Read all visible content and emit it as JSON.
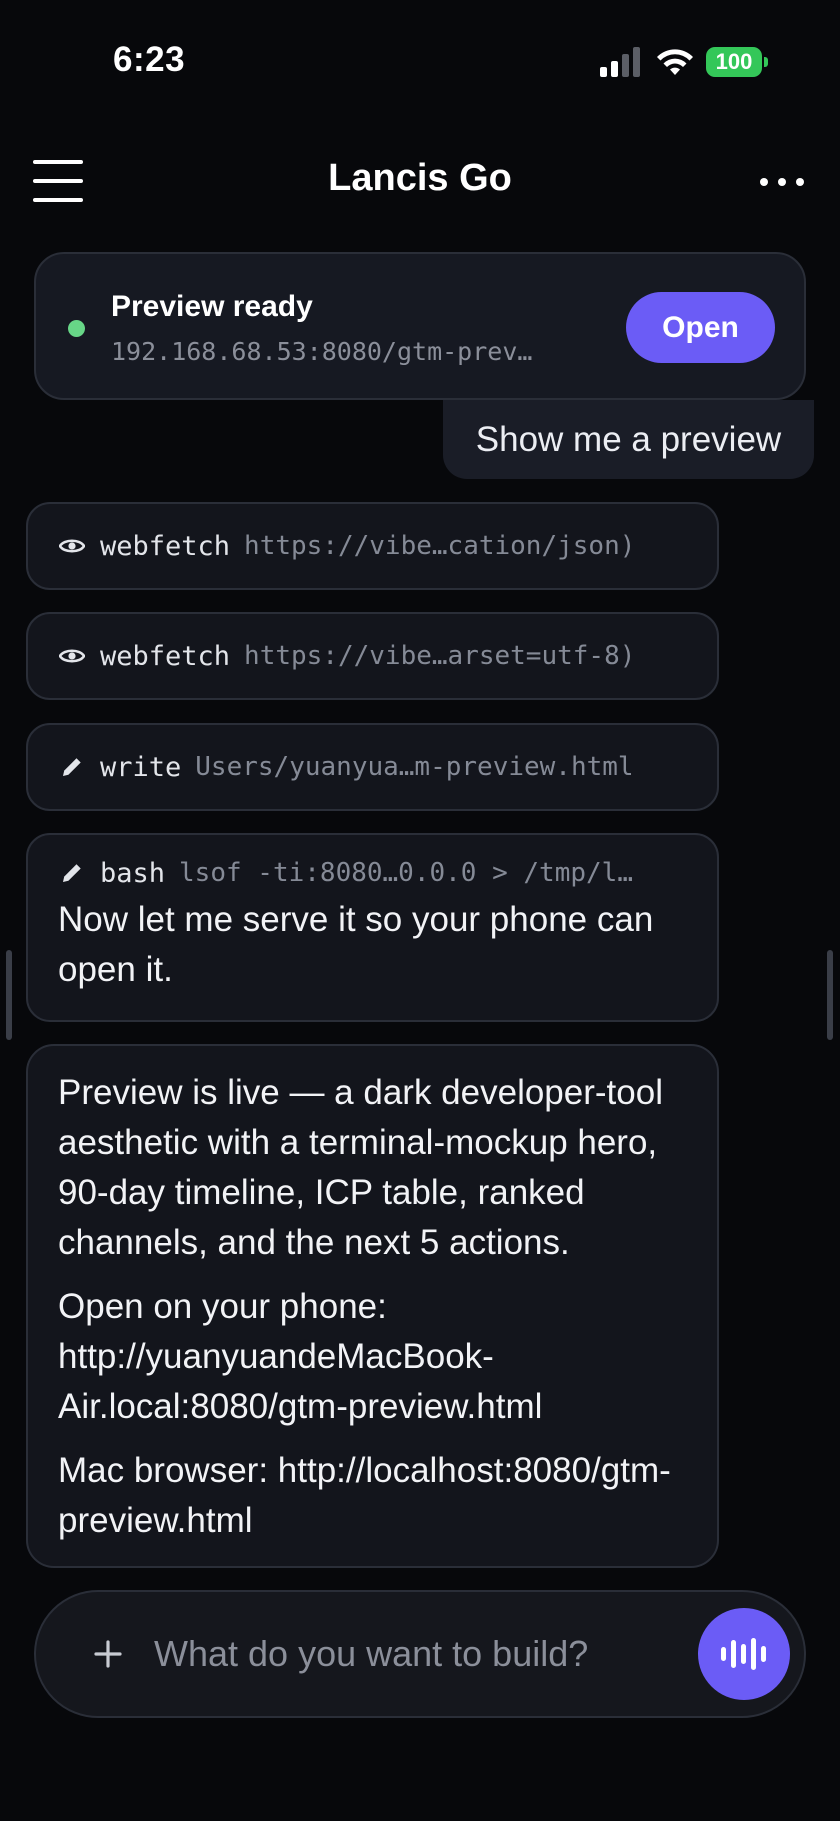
{
  "status_bar": {
    "time": "6:23",
    "battery": "100",
    "icons": [
      "cellular-signal-icon",
      "wifi-icon",
      "battery-icon"
    ]
  },
  "header": {
    "title": "Lancis Go",
    "menu_icon": "hamburger-menu-icon",
    "more_icon": "more-dots-icon"
  },
  "preview": {
    "title": "Preview ready",
    "url": "192.168.68.53:8080/gtm-prev…",
    "open_label": "Open",
    "status_color": "#67d687"
  },
  "user_message": "Show me a preview",
  "tools": [
    {
      "icon": "eye-icon",
      "name": "webfetch",
      "arg": "https://vibe…cation/json)"
    },
    {
      "icon": "eye-icon",
      "name": "webfetch",
      "arg": "https://vibe…arset=utf-8)"
    },
    {
      "icon": "pencil-icon",
      "name": "write",
      "arg": "Users/yuanyua…m-preview.html"
    }
  ],
  "bash": {
    "icon": "pencil-icon",
    "name": "bash",
    "arg": "lsof -ti:8080…0.0.0 > /tmp/l…",
    "text": "Now let me serve it so your phone can open it."
  },
  "assistant_message": {
    "p1": "Preview is live — a dark developer-tool aesthetic with a terminal-mockup hero, 90-day timeline, ICP table, ranked channels, and the next 5 actions.",
    "p2": "Open on your phone:  http://yuanyuandeMacBook-Air.local:8080/gtm-preview.html",
    "p3": "Mac browser: http://localhost:8080/gtm-preview.html"
  },
  "composer": {
    "placeholder": "What do you want to build?",
    "add_icon": "plus-icon",
    "voice_icon": "voice-waveform-icon"
  },
  "colors": {
    "accent": "#6b5cf6",
    "background": "#07080b",
    "card": "#13151c"
  }
}
